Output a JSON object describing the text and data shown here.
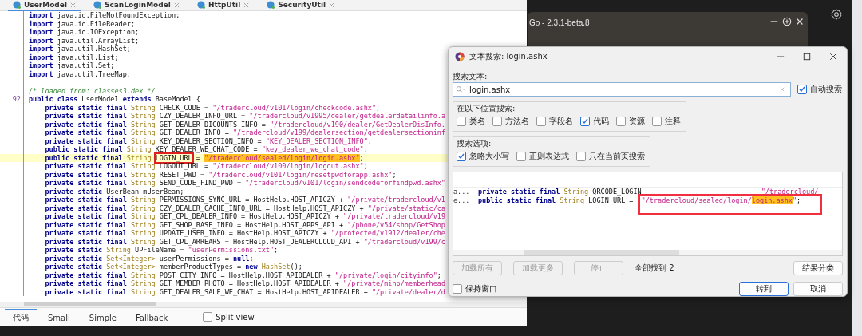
{
  "editor": {
    "tabs": [
      {
        "label": "UserModel",
        "selected": true
      },
      {
        "label": "ScanLoginModel",
        "selected": false
      },
      {
        "label": "HttpUtil",
        "selected": false
      },
      {
        "label": "SecurityUtil",
        "selected": false
      }
    ],
    "lines": [
      {
        "highlighted": false,
        "tokens": [
          {
            "kind": "k",
            "text": "import "
          },
          {
            "kind": "p",
            "text": "java.io.FileNotFoundException;"
          }
        ]
      },
      {
        "highlighted": false,
        "tokens": [
          {
            "kind": "k",
            "text": "import "
          },
          {
            "kind": "p",
            "text": "java.io.FileReader;"
          }
        ]
      },
      {
        "highlighted": false,
        "tokens": [
          {
            "kind": "k",
            "text": "import "
          },
          {
            "kind": "p",
            "text": "java.io.IOException;"
          }
        ]
      },
      {
        "highlighted": false,
        "tokens": [
          {
            "kind": "k",
            "text": "import "
          },
          {
            "kind": "p",
            "text": "java.util.ArrayList;"
          }
        ]
      },
      {
        "highlighted": false,
        "tokens": [
          {
            "kind": "k",
            "text": "import "
          },
          {
            "kind": "p",
            "text": "java.util.HashSet;"
          }
        ]
      },
      {
        "highlighted": false,
        "tokens": [
          {
            "kind": "k",
            "text": "import "
          },
          {
            "kind": "p",
            "text": "java.util.List;"
          }
        ]
      },
      {
        "highlighted": false,
        "tokens": [
          {
            "kind": "k",
            "text": "import "
          },
          {
            "kind": "p",
            "text": "java.util.Set;"
          }
        ]
      },
      {
        "highlighted": false,
        "tokens": [
          {
            "kind": "k",
            "text": "import "
          },
          {
            "kind": "p",
            "text": "java.util.TreeMap;"
          }
        ]
      },
      {
        "highlighted": false
      },
      {
        "highlighted": false,
        "tokens": [
          {
            "kind": "c",
            "text": "/* loaded from: classes3.dex */"
          }
        ]
      },
      {
        "highlighted": false,
        "number": "92",
        "tokens": [
          {
            "kind": "k",
            "text": "public class "
          },
          {
            "kind": "p",
            "text": "UserModel "
          },
          {
            "kind": "k",
            "text": "extends "
          },
          {
            "kind": "p",
            "text": "BaseModel {"
          }
        ]
      },
      {
        "highlighted": false,
        "tokens": [
          {
            "kind": "k",
            "text": "    private static final "
          },
          {
            "kind": "t",
            "text": "String "
          },
          {
            "kind": "p",
            "text": "CHECK_CODE = "
          },
          {
            "kind": "s",
            "text": "\"/tradercloud/v101/login/checkcode.ashx\""
          },
          {
            "kind": "p",
            "text": ";"
          }
        ]
      },
      {
        "highlighted": false,
        "tokens": [
          {
            "kind": "k",
            "text": "    private static final "
          },
          {
            "kind": "t",
            "text": "String "
          },
          {
            "kind": "p",
            "text": "CZY_DEALER_INFO_URL = "
          },
          {
            "kind": "s",
            "text": "\"/tradercloud/v1995/dealer/getdealerdetailinfo.a"
          }
        ]
      },
      {
        "highlighted": false,
        "tokens": [
          {
            "kind": "k",
            "text": "    private static final "
          },
          {
            "kind": "t",
            "text": "String "
          },
          {
            "kind": "p",
            "text": "GET_DEALER_DICOUNTS_INFO = "
          },
          {
            "kind": "s",
            "text": "\"/tradercloud/v190/dealer/GetDealerDisInfo."
          }
        ]
      },
      {
        "highlighted": false,
        "tokens": [
          {
            "kind": "k",
            "text": "    private static final "
          },
          {
            "kind": "t",
            "text": "String "
          },
          {
            "kind": "p",
            "text": "GET_DEALER_INFO = "
          },
          {
            "kind": "s",
            "text": "\"/tradercloud/v199/dealersection/getdealersectioninf"
          }
        ]
      },
      {
        "highlighted": false,
        "tokens": [
          {
            "kind": "k",
            "text": "    private static final "
          },
          {
            "kind": "t",
            "text": "String "
          },
          {
            "kind": "p",
            "text": "KEY_DEALER_SECTION_INFO = "
          },
          {
            "kind": "s",
            "text": "\"KEY_DEALER_SECTION_INFO\""
          },
          {
            "kind": "p",
            "text": ";"
          }
        ]
      },
      {
        "highlighted": false,
        "tokens": [
          {
            "kind": "k",
            "text": "    public static final "
          },
          {
            "kind": "t",
            "text": "String "
          },
          {
            "kind": "p",
            "text": "KEY_DEALER_WE_CHAT_CODE = "
          },
          {
            "kind": "s",
            "text": "\"key_dealer_we_chat_code\""
          },
          {
            "kind": "p",
            "text": ";"
          }
        ]
      },
      {
        "highlighted": true,
        "tokens": [
          {
            "kind": "k",
            "text": "    public static final "
          },
          {
            "kind": "t",
            "text": "String "
          },
          {
            "kind": "b",
            "text": "LOGIN_URL"
          },
          {
            "kind": "p",
            "text": " = "
          },
          {
            "kind": "m",
            "text": "\"/tradercloud/sealed/login/login.ashx\""
          },
          {
            "kind": "p",
            "text": ";"
          }
        ]
      },
      {
        "highlighted": false,
        "tokens": [
          {
            "kind": "k",
            "text": "    private static final "
          },
          {
            "kind": "t",
            "text": "String "
          },
          {
            "kind": "p",
            "text": "LOGOUT_URL = "
          },
          {
            "kind": "s",
            "text": "\"/tradercloud/v100/login/logout.ashx\""
          },
          {
            "kind": "p",
            "text": ";"
          }
        ]
      },
      {
        "highlighted": false,
        "tokens": [
          {
            "kind": "k",
            "text": "    private static final "
          },
          {
            "kind": "t",
            "text": "String "
          },
          {
            "kind": "p",
            "text": "RESET_PWD = "
          },
          {
            "kind": "s",
            "text": "\"/tradercloud/v101/login/resetpwdforapp.ashx\""
          },
          {
            "kind": "p",
            "text": ";"
          }
        ]
      },
      {
        "highlighted": false,
        "tokens": [
          {
            "kind": "k",
            "text": "    private static final "
          },
          {
            "kind": "t",
            "text": "String "
          },
          {
            "kind": "p",
            "text": "SEND_CODE_FIND_PWD = "
          },
          {
            "kind": "s",
            "text": "\"/tradercloud/v101/login/sendcodeforfindpwd.ashx\""
          }
        ]
      },
      {
        "highlighted": false,
        "tokens": [
          {
            "kind": "k",
            "text": "    private static "
          },
          {
            "kind": "p",
            "text": "UserBean mUserBean;"
          }
        ]
      },
      {
        "highlighted": false,
        "tokens": [
          {
            "kind": "k",
            "text": "    private static final "
          },
          {
            "kind": "t",
            "text": "String "
          },
          {
            "kind": "p",
            "text": "PERMISSIONS_SYNC_URL = HostHelp.HOST_APICZY + "
          },
          {
            "kind": "s",
            "text": "\"/private/tradercloud/v1"
          }
        ]
      },
      {
        "highlighted": false,
        "tokens": [
          {
            "kind": "k",
            "text": "    private static final "
          },
          {
            "kind": "t",
            "text": "String "
          },
          {
            "kind": "p",
            "text": "CZY_DEALER_CACHE_INFO_URL = HostHelp.HOST_APICZY + "
          },
          {
            "kind": "s",
            "text": "\"/private/static/ca"
          }
        ]
      },
      {
        "highlighted": false,
        "tokens": [
          {
            "kind": "k",
            "text": "    private static final "
          },
          {
            "kind": "t",
            "text": "String "
          },
          {
            "kind": "p",
            "text": "GET_CPL_DEALER_INFO = HostHelp.HOST_APICZY + "
          },
          {
            "kind": "s",
            "text": "\"/private/tradercloud/v19"
          }
        ]
      },
      {
        "highlighted": false,
        "tokens": [
          {
            "kind": "k",
            "text": "    private static final "
          },
          {
            "kind": "t",
            "text": "String "
          },
          {
            "kind": "p",
            "text": "GET_SHOP_BASE_INFO = HostHelp.HOST_APPS_API + "
          },
          {
            "kind": "s",
            "text": "\"/phone/v54/shop/GetShop"
          }
        ]
      },
      {
        "highlighted": false,
        "tokens": [
          {
            "kind": "k",
            "text": "    private static final "
          },
          {
            "kind": "t",
            "text": "String "
          },
          {
            "kind": "p",
            "text": "UPDATE_USER_INFO = HostHelp.HOST_APICZY + "
          },
          {
            "kind": "s",
            "text": "\"/protected/v1912/dealer/che"
          }
        ]
      },
      {
        "highlighted": false,
        "tokens": [
          {
            "kind": "k",
            "text": "    private static final "
          },
          {
            "kind": "t",
            "text": "String "
          },
          {
            "kind": "p",
            "text": "GET_CPL_ARREARS = HostHelp.HOST_DEALERCLOUD_API + "
          },
          {
            "kind": "s",
            "text": "\"/tradercloud/v199/c"
          }
        ]
      },
      {
        "highlighted": false,
        "tokens": [
          {
            "kind": "k",
            "text": "    private static "
          },
          {
            "kind": "t",
            "text": "String "
          },
          {
            "kind": "p",
            "text": "UPFileName = "
          },
          {
            "kind": "s",
            "text": "\"userPermissions.txt\""
          },
          {
            "kind": "p",
            "text": ";"
          }
        ]
      },
      {
        "highlighted": false,
        "tokens": [
          {
            "kind": "k",
            "text": "    private static "
          },
          {
            "kind": "t",
            "text": "Set<Integer> "
          },
          {
            "kind": "p",
            "text": "userPermissions = "
          },
          {
            "kind": "k",
            "text": "null"
          },
          {
            "kind": "p",
            "text": ";"
          }
        ]
      },
      {
        "highlighted": false,
        "tokens": [
          {
            "kind": "k",
            "text": "    private static "
          },
          {
            "kind": "t",
            "text": "Set<Integer> "
          },
          {
            "kind": "p",
            "text": "memberProductTypes = "
          },
          {
            "kind": "k",
            "text": "new "
          },
          {
            "kind": "t",
            "text": "HashSet"
          },
          {
            "kind": "p",
            "text": "();"
          }
        ]
      },
      {
        "highlighted": false,
        "tokens": [
          {
            "kind": "k",
            "text": "    private static final "
          },
          {
            "kind": "t",
            "text": "String "
          },
          {
            "kind": "p",
            "text": "POST_CITY_INFO = HostHelp.HOST_APIDEALER + "
          },
          {
            "kind": "s",
            "text": "\"/private/login/cityinfo\""
          },
          {
            "kind": "p",
            "text": ";"
          }
        ]
      },
      {
        "highlighted": false,
        "tokens": [
          {
            "kind": "k",
            "text": "    private static final "
          },
          {
            "kind": "t",
            "text": "String "
          },
          {
            "kind": "p",
            "text": "GET_MEMBER_PHOTO = HostHelp.HOST_APIDEALER + "
          },
          {
            "kind": "s",
            "text": "\"/private/minp/memberhead"
          }
        ]
      },
      {
        "highlighted": false,
        "tokens": [
          {
            "kind": "k",
            "text": "    private static final "
          },
          {
            "kind": "t",
            "text": "String "
          },
          {
            "kind": "p",
            "text": "GET_DEALER_SALE_WE_CHAT = HostHelp.HOST_APIDEALER + "
          },
          {
            "kind": "s",
            "text": "\"/private/dealer/d"
          }
        ]
      }
    ],
    "bottom_tabs": [
      {
        "label": "代码",
        "selected": true
      },
      {
        "label": "Smali",
        "selected": false
      },
      {
        "label": "Simple",
        "selected": false
      },
      {
        "label": "Fallback",
        "selected": false
      }
    ],
    "split_view": {
      "label": "Split view",
      "checked": false
    }
  },
  "go_window": {
    "title": "Go - 2.3.1-beta.8"
  },
  "dialog": {
    "title": "文本搜索: login.ashx",
    "search_label": "搜索文本:",
    "search": {
      "value": "login.ashx"
    },
    "auto_search": {
      "label": "自动搜索",
      "checked": true
    },
    "scope": {
      "title": "在以下位置搜索:",
      "options": [
        {
          "label": "类名",
          "checked": false
        },
        {
          "label": "方法名",
          "checked": false
        },
        {
          "label": "字段名",
          "checked": false
        },
        {
          "label": "代码",
          "checked": true
        },
        {
          "label": "资源",
          "checked": false
        },
        {
          "label": "注释",
          "checked": false
        }
      ]
    },
    "search_options": {
      "title": "搜索选项:",
      "options": [
        {
          "label": "忽略大小写",
          "checked": true
        },
        {
          "label": "正则表达式",
          "checked": false
        },
        {
          "label": "只在当前页搜索",
          "checked": false
        }
      ]
    },
    "results": [
      {
        "location": "a...",
        "tokens": [
          {
            "kind": "k",
            "text": "private static final "
          },
          {
            "kind": "t",
            "text": "String "
          },
          {
            "kind": "p",
            "text": "QRCODE_LOGIN"
          },
          {
            "kind": "tail",
            "text": "\"/tradercloud/"
          }
        ]
      },
      {
        "location": "e...",
        "tokens": [
          {
            "kind": "k",
            "text": "public static final "
          },
          {
            "kind": "t",
            "text": "String "
          },
          {
            "kind": "p",
            "text": "LOGIN_URL = "
          }
        ],
        "annotated_tokens": [
          {
            "kind": "s",
            "text": "\"/tradercloud/sealed/login/"
          },
          {
            "kind": "m",
            "text": "login.ashx"
          },
          {
            "kind": "s",
            "text": "\""
          },
          {
            "kind": "p",
            "text": ";"
          }
        ]
      }
    ],
    "load_buttons": [
      {
        "label": "加载所有",
        "disabled": true
      },
      {
        "label": "加载更多",
        "disabled": true
      },
      {
        "label": "停止",
        "disabled": true
      }
    ],
    "found": "全部找到 2",
    "group_button": "结果分类",
    "keep_window": {
      "label": "保持窗口",
      "checked": false
    },
    "actions": [
      {
        "label": "转到",
        "default": true
      },
      {
        "label": "取消",
        "default": false
      }
    ]
  }
}
